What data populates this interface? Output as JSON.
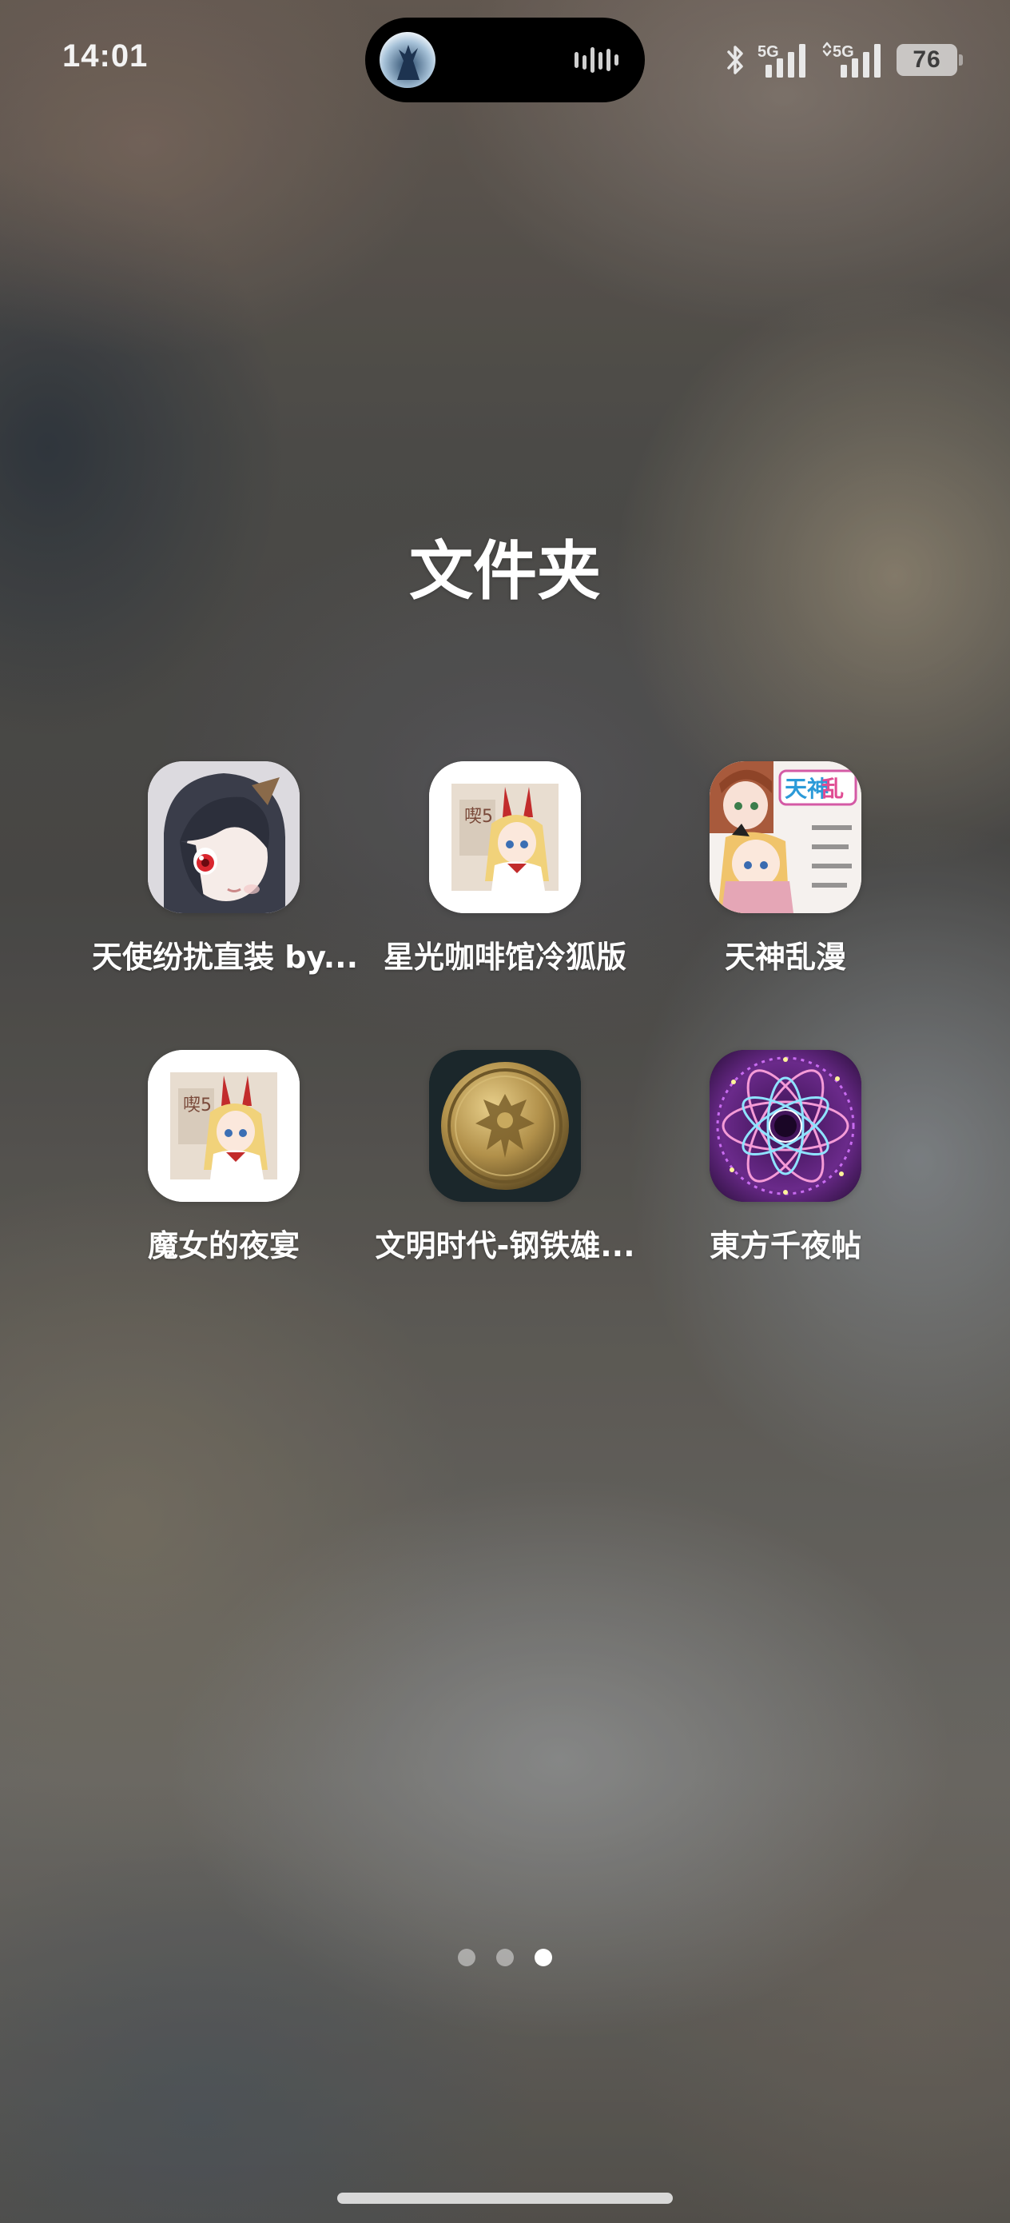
{
  "status_bar": {
    "time": "14:01",
    "network_1": "5G",
    "network_2": "5G",
    "battery": "76",
    "icons": [
      "bluetooth-icon",
      "signal-5g-icon",
      "signal-5g-data-icon",
      "battery-icon"
    ]
  },
  "dynamic_island": {
    "avatar_icon": "music-avatar-icon",
    "activity_icon": "audio-waveform-icon"
  },
  "folder": {
    "title": "文件夹",
    "apps": [
      {
        "label": "天使纷扰直装 by...",
        "icon": "anime-girl-dark-hair-icon"
      },
      {
        "label": "星光咖啡馆冷狐版",
        "icon": "anime-girl-bunny-ears-icon"
      },
      {
        "label": "天神乱漫",
        "icon": "anime-girls-poster-icon"
      },
      {
        "label": "魔女的夜宴",
        "icon": "anime-girl-bunny-ears-icon"
      },
      {
        "label": "文明时代-钢铁雄...",
        "icon": "gold-coin-eagle-icon"
      },
      {
        "label": "東方千夜帖",
        "icon": "purple-mandala-icon"
      }
    ]
  },
  "pagination": {
    "pages": 3,
    "current_page": 3
  }
}
